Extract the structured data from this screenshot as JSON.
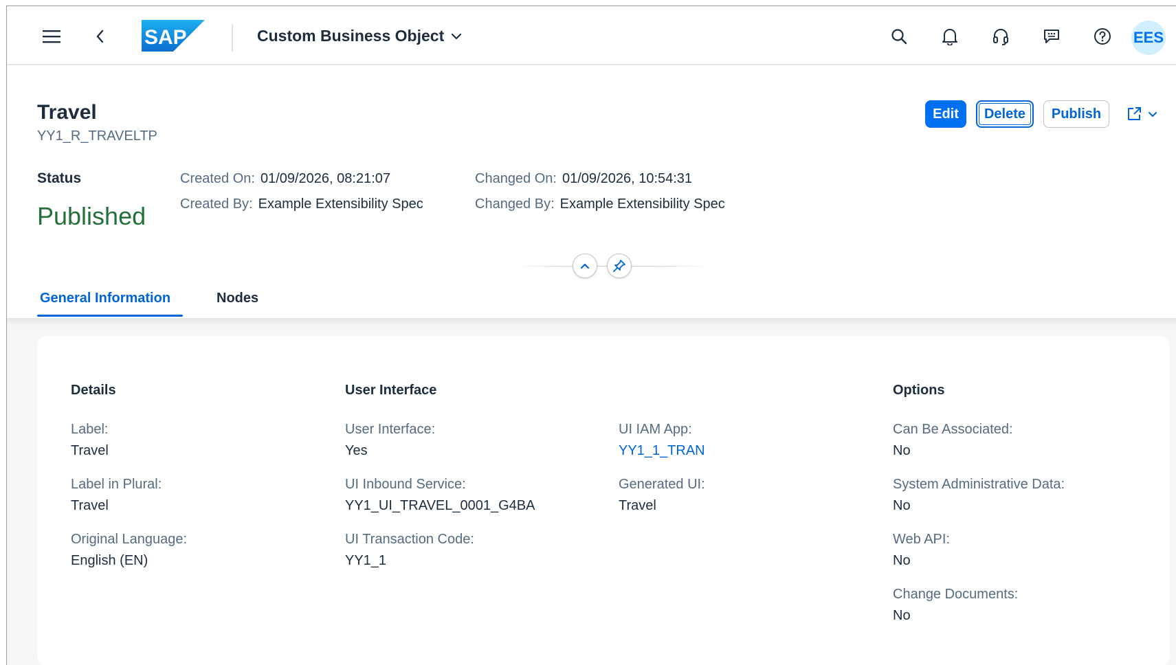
{
  "shell": {
    "app_title": "Custom Business Object",
    "avatar_initials": "EES",
    "brand_color": "#0070f2"
  },
  "header": {
    "title": "Travel",
    "subtitle": "YY1_R_TRAVELTP",
    "actions": {
      "edit": "Edit",
      "delete": "Delete",
      "publish": "Publish"
    },
    "status_label": "Status",
    "status_value": "Published",
    "status_color": "#256f3a",
    "created_on_label": "Created On:",
    "created_on_value": "01/09/2026, 08:21:07",
    "created_by_label": "Created By:",
    "created_by_value": "Example Extensibility Spec",
    "changed_on_label": "Changed On:",
    "changed_on_value": "01/09/2026, 10:54:31",
    "changed_by_label": "Changed By:",
    "changed_by_value": "Example Extensibility Spec"
  },
  "tabs": [
    {
      "label": "General Information",
      "active": true
    },
    {
      "label": "Nodes",
      "active": false
    }
  ],
  "sections": {
    "details": {
      "title": "Details",
      "fields": [
        {
          "label": "Label:",
          "value": "Travel"
        },
        {
          "label": "Label in Plural:",
          "value": "Travel"
        },
        {
          "label": "Original Language:",
          "value": "English (EN)"
        }
      ]
    },
    "user_interface": {
      "title": "User Interface",
      "fields": [
        {
          "label": "User Interface:",
          "value": "Yes"
        },
        {
          "label": "UI Inbound Service:",
          "value": "YY1_UI_TRAVEL_0001_G4BA"
        },
        {
          "label": "UI Transaction Code:",
          "value": "YY1_1"
        }
      ],
      "fields_col2": [
        {
          "label": "UI IAM App:",
          "value": "YY1_1_TRAN"
        },
        {
          "label": "Generated UI:",
          "value": "Travel"
        }
      ]
    },
    "options": {
      "title": "Options",
      "fields": [
        {
          "label": "Can Be Associated:",
          "value": "No"
        },
        {
          "label": "System Administrative Data:",
          "value": "No"
        },
        {
          "label": "Web API:",
          "value": "No"
        },
        {
          "label": "Change Documents:",
          "value": "No"
        }
      ]
    }
  }
}
